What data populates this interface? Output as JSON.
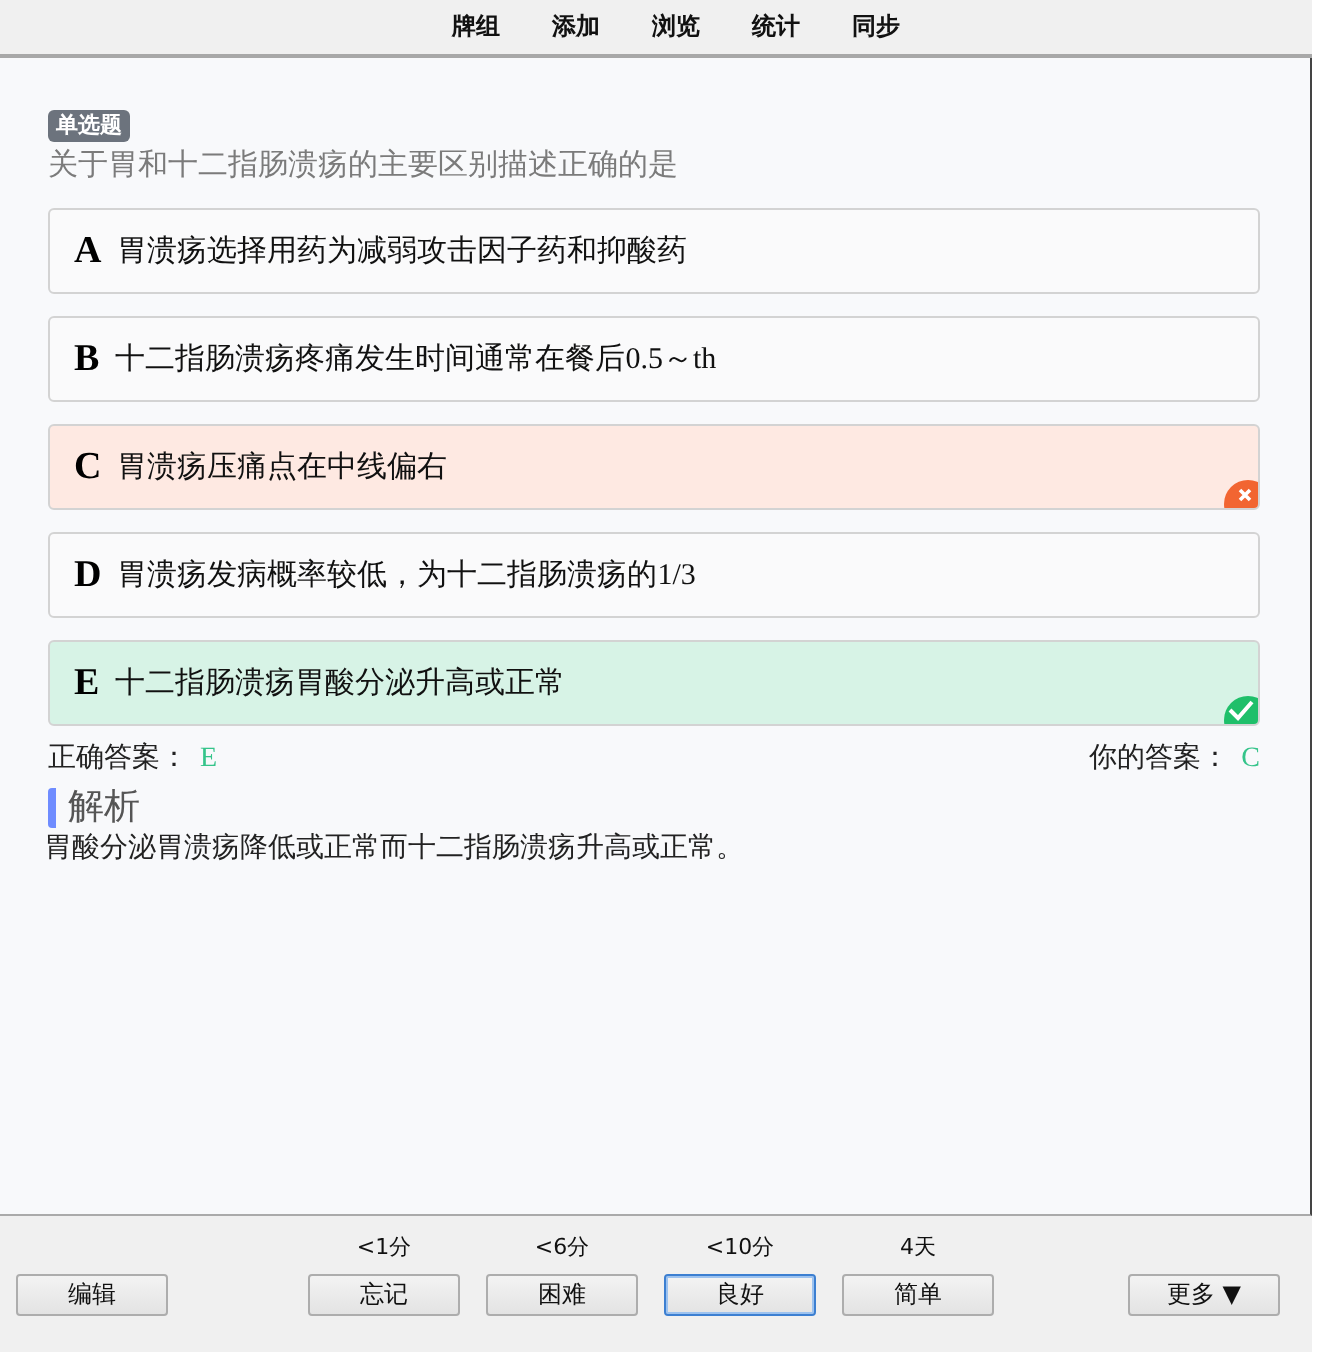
{
  "menu": [
    "牌组",
    "添加",
    "浏览",
    "统计",
    "同步"
  ],
  "question": {
    "type_badge": "单选题",
    "text": "关于胃和十二指肠溃疡的主要区别描述正确的是"
  },
  "options": [
    {
      "letter": "A",
      "text": "胃溃疡选择用药为减弱攻击因子药和抑酸药",
      "kind": "plain"
    },
    {
      "letter": "B",
      "text": "十二指肠溃疡疼痛发生时间通常在餐后0.5～th",
      "kind": "plain"
    },
    {
      "letter": "C",
      "text": "胃溃疡压痛点在中线偏右",
      "kind": "wrong"
    },
    {
      "letter": "D",
      "text": "胃溃疡发病概率较低，为十二指肠溃疡的1/3",
      "kind": "plain"
    },
    {
      "letter": "E",
      "text": "十二指肠溃疡胃酸分泌升高或正常",
      "kind": "correct"
    }
  ],
  "correct_answer": {
    "label": "正确答案：",
    "value": "E"
  },
  "your_answer": {
    "label": "你的答案：",
    "value": "C"
  },
  "explanation": {
    "title": "解析",
    "text": "胃酸分泌胃溃疡降低或正常而十二指肠溃疡升高或正常。"
  },
  "bottom_bar": {
    "edit": "编辑",
    "more": "更多 ▼",
    "ease": [
      {
        "interval": "<1分",
        "label": "忘记",
        "selected": false
      },
      {
        "interval": "<6分",
        "label": "困难",
        "selected": false
      },
      {
        "interval": "<10分",
        "label": "良好",
        "selected": true
      },
      {
        "interval": "4天",
        "label": "简单",
        "selected": false
      }
    ]
  }
}
